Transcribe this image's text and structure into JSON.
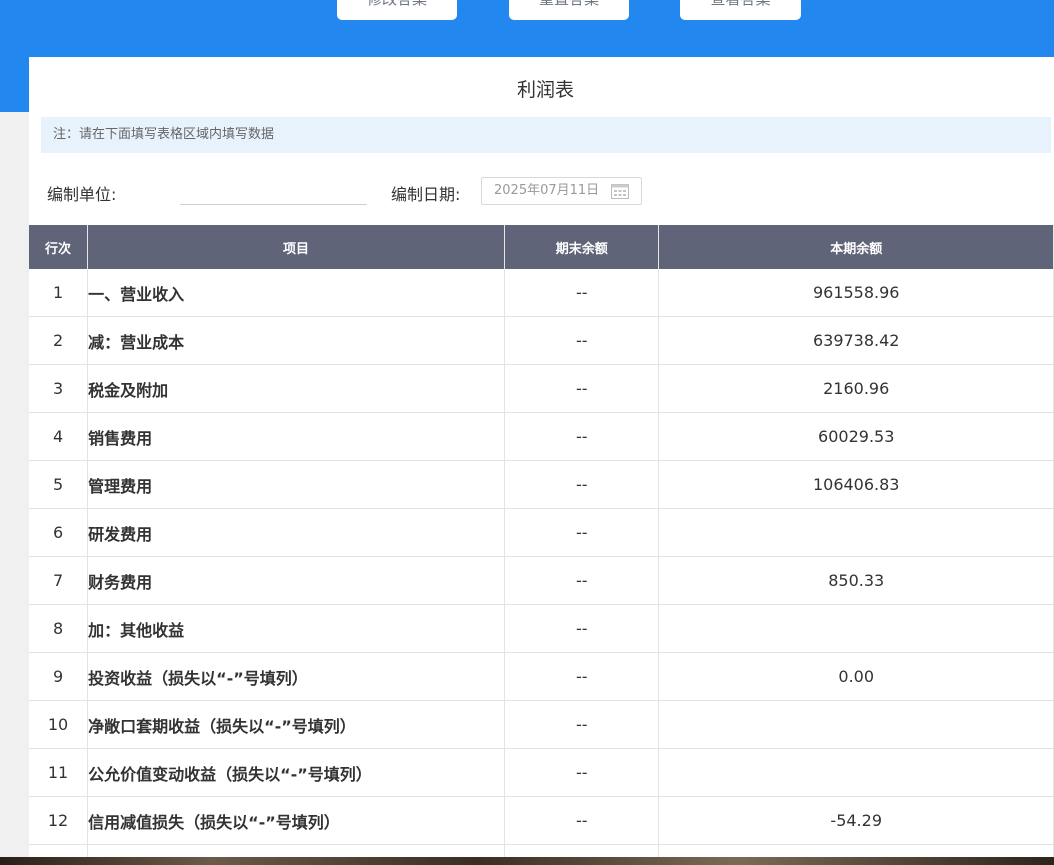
{
  "toolbar": {
    "modify_label": "修改答案",
    "reset_label": "重置答案",
    "view_label": "查看答案"
  },
  "report": {
    "title": "利润表",
    "note": "注：请在下面填写表格区域内填写数据",
    "unit_label": "编制单位:",
    "unit_value": "",
    "date_label": "编制日期:",
    "date_value": "2025年07月11日"
  },
  "table": {
    "headers": {
      "no": "行次",
      "item": "项目",
      "end_balance": "期末余额",
      "current_balance": "本期余额"
    },
    "rows": [
      {
        "no": "1",
        "item": "一、营业收入",
        "end": "--",
        "cur": "961558.96"
      },
      {
        "no": "2",
        "item": "减：营业成本",
        "end": "--",
        "cur": "639738.42"
      },
      {
        "no": "3",
        "item": "税金及附加",
        "end": "--",
        "cur": "2160.96"
      },
      {
        "no": "4",
        "item": "销售费用",
        "end": "--",
        "cur": "60029.53"
      },
      {
        "no": "5",
        "item": "管理费用",
        "end": "--",
        "cur": "106406.83"
      },
      {
        "no": "6",
        "item": "研发费用",
        "end": "--",
        "cur": ""
      },
      {
        "no": "7",
        "item": "财务费用",
        "end": "--",
        "cur": "850.33"
      },
      {
        "no": "8",
        "item": "加：其他收益",
        "end": "--",
        "cur": ""
      },
      {
        "no": "9",
        "item": "投资收益（损失以“-”号填列）",
        "end": "--",
        "cur": "0.00"
      },
      {
        "no": "10",
        "item": "净敞口套期收益（损失以“-”号填列）",
        "end": "--",
        "cur": ""
      },
      {
        "no": "11",
        "item": "公允价值变动收益（损失以“-”号填列）",
        "end": "--",
        "cur": ""
      },
      {
        "no": "12",
        "item": "信用减值损失（损失以“-”号填列）",
        "end": "--",
        "cur": "-54.29"
      },
      {
        "no": "",
        "item": "",
        "end": "",
        "cur": ""
      }
    ]
  },
  "colors": {
    "header_band": "#2387f0",
    "table_header": "#5f6478",
    "note_bg": "#e8f2fd"
  },
  "icons": {
    "date_picker": "calendar-icon"
  }
}
